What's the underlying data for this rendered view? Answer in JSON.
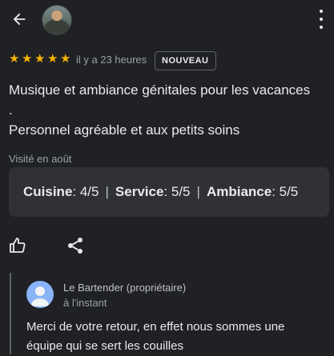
{
  "header": {
    "back_icon": "arrow-left-icon",
    "more_icon": "more-vert-icon"
  },
  "review": {
    "rating": 5,
    "rating_max": 5,
    "star_color": "#f6b400",
    "time": "il y a 23 heures",
    "badge": "NOUVEAU",
    "lines": [
      "Musique et ambiance génitales pour les vacances",
      ".",
      "Personnel agréable et aux petits soins"
    ],
    "visited": "Visité en août",
    "ratings": {
      "cuisine_label": "Cuisine",
      "cuisine_value": " : 4/5",
      "service_label": "Service",
      "service_value": " : 5/5",
      "ambiance_label": "Ambiance",
      "ambiance_value": " : 5/5",
      "separator": "|"
    },
    "like_icon": "thumb-up-icon",
    "share_icon": "share-icon"
  },
  "reply": {
    "name": "Le Bartender (propriétaire)",
    "time": "à l'instant",
    "text": "Merci de votre retour, en effet nous sommes une équipe qui se sert les couilles",
    "avatar_color": "#8ab4f8"
  }
}
